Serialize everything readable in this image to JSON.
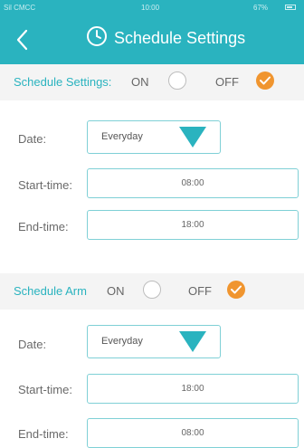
{
  "status_bar": {
    "carrier": "Sil CMCC",
    "time": "10:00",
    "battery": "67%"
  },
  "header": {
    "back_icon": "chevron-left-icon",
    "title_icon": "clock-icon",
    "title": "Schedule Settings"
  },
  "schedule_settings": {
    "title": "Schedule Settings:",
    "on_label": "ON",
    "off_label": "OFF",
    "state": "OFF",
    "date_label": "Date:",
    "date_value": "Everyday",
    "start_label": "Start-time:",
    "start_value": "08:00",
    "end_label": "End-time:",
    "end_value": "18:00"
  },
  "schedule_arm": {
    "title": "Schedule Arm",
    "on_label": "ON",
    "off_label": "OFF",
    "state": "OFF",
    "date_label": "Date:",
    "date_value": "Everyday",
    "start_label": "Start-time:",
    "start_value": "18:00",
    "end_label": "End-time:",
    "end_value": "08:00"
  },
  "colors": {
    "header_bg": "#2ab3bf",
    "accent": "#2ab3bf",
    "checked": "#f0952f"
  }
}
